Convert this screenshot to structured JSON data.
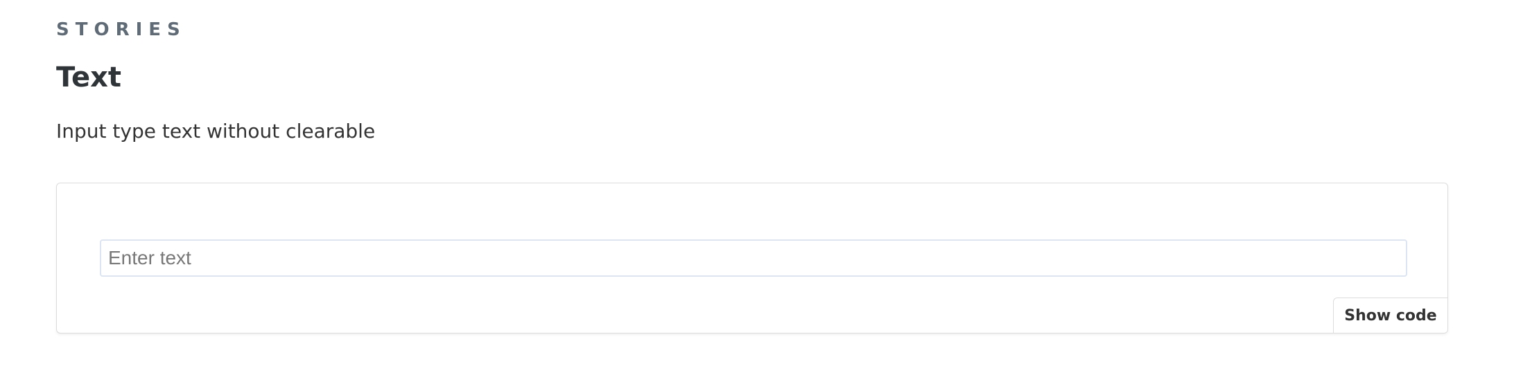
{
  "docs": {
    "section_label": "STORIES",
    "story_title": "Text",
    "story_description": "Input type text without clearable"
  },
  "preview": {
    "input": {
      "value": "",
      "placeholder": "Enter text"
    },
    "show_code_label": "Show code"
  }
}
